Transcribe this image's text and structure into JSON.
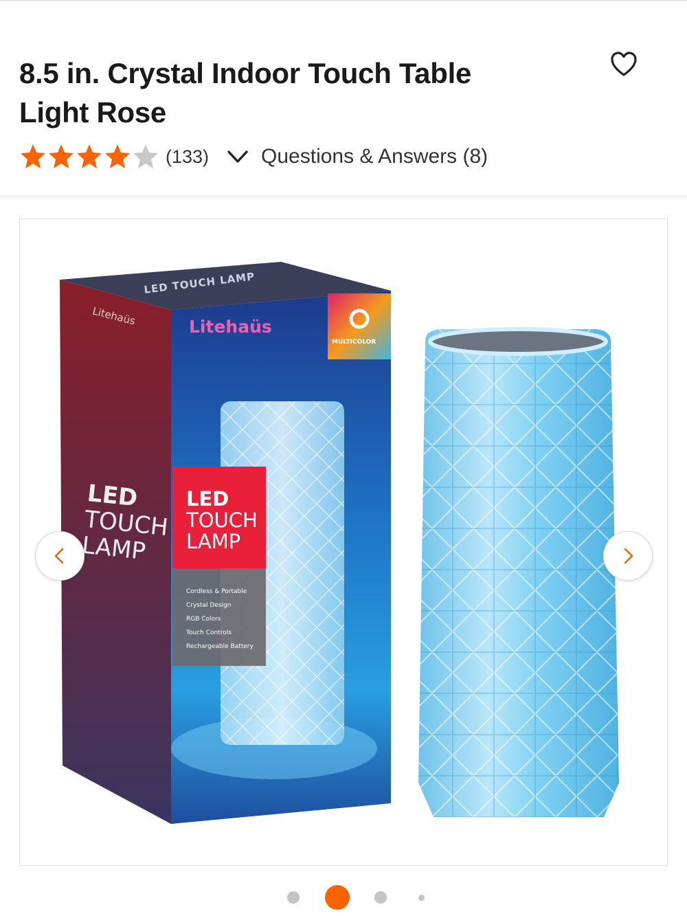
{
  "product": {
    "title_line1": "8.5 in. Crystal Indoor Touch Table",
    "title_line2": "Light Rose",
    "rating": 4,
    "rating_max": 5,
    "review_count": "(133)",
    "qa_label": "Questions & Answers (8)"
  },
  "icons": {
    "favorite": "heart-outline-icon",
    "expand": "chevron-down-icon",
    "prev": "chevron-left-icon",
    "next": "chevron-right-icon",
    "star": "star-icon"
  },
  "image": {
    "box_brand": "Litehaüs",
    "box_side_brand": "Litehaüs",
    "box_top_text": "LED TOUCH LAMP",
    "box_badge": "MULTICOLOR",
    "box_side_led": "LED",
    "box_side_touch": "TOUCH",
    "box_side_lamp": "LAMP",
    "label_led": "LED",
    "label_touch": "TOUCH",
    "label_lamp": "LAMP",
    "features": [
      "Cordless & Portable",
      "Crystal Design",
      "RGB Colors",
      "Touch Controls",
      "Rechargeable Battery"
    ]
  },
  "carousel": {
    "active_index": 1,
    "total": 4
  },
  "colors": {
    "accent": "#f96302",
    "star_filled": "#f96302",
    "star_empty": "#c8c8c8",
    "dot_inactive": "#c4c4c4"
  }
}
